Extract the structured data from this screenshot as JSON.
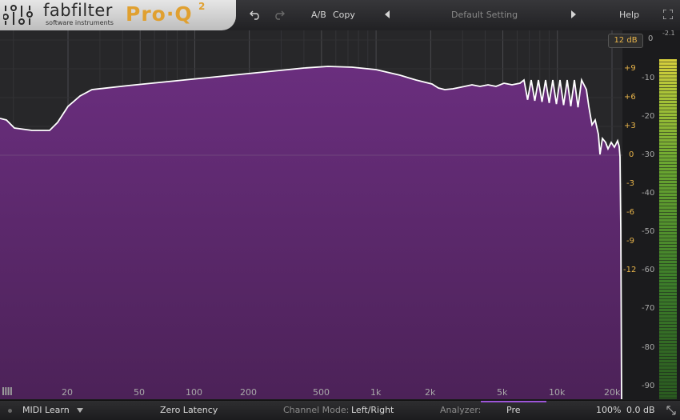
{
  "header": {
    "brand": "fabfilter",
    "brand_sub": "software instruments",
    "product": "Pro·Q",
    "product_sup": "2",
    "ab_label": "A/B",
    "copy_label": "Copy",
    "preset_name": "Default Setting",
    "help_label": "Help"
  },
  "scales": {
    "range": "12 dB",
    "gain_ticks": [
      "+9",
      "+6",
      "+3",
      "0",
      "-3",
      "-6",
      "-9",
      "-12"
    ],
    "db_ticks": [
      "0",
      "-10",
      "-20",
      "-30",
      "-40",
      "-50",
      "-60",
      "-70",
      "-80",
      "-90"
    ],
    "meter_peak": "-2.1"
  },
  "frequency_labels": [
    "20",
    "50",
    "100",
    "200",
    "500",
    "1k",
    "2k",
    "5k",
    "10k",
    "20k"
  ],
  "footer": {
    "midi_learn": "MIDI Learn",
    "latency": "Zero Latency",
    "channel_mode_label": "Channel Mode:",
    "channel_mode_value": "Left/Right",
    "analyzer_label": "Analyzer:",
    "analyzer_value": "Pre",
    "zoom": "100%",
    "output_gain": "0.0 dB"
  },
  "colors": {
    "spectrum_fill": "#5e2a70",
    "curve": "#ffffff",
    "gain_scale": "#e8b44a",
    "product": "#e0a030"
  }
}
